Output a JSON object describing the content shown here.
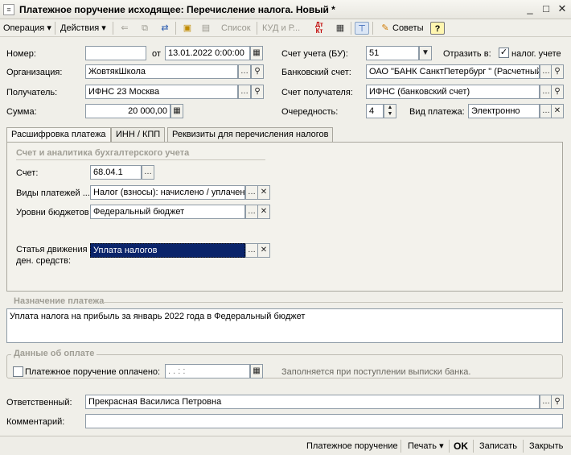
{
  "window": {
    "title": "Платежное поручение исходящее: Перечисление налога. Новый *",
    "controls": [
      "_",
      "□",
      "✕"
    ]
  },
  "toolbar": {
    "operation": "Операция",
    "actions": "Действия",
    "list": "Список",
    "kud": "КУД и Р...",
    "dt_kt": "Дт Кт",
    "advice": "Советы",
    "help": "?"
  },
  "form": {
    "number_label": "Номер:",
    "number_value": "",
    "from_label": "от",
    "date_value": "13.01.2022  0:00:00",
    "account_bu_label": "Счет учета (БУ):",
    "account_bu_value": "51",
    "reflect_label": "Отразить в:",
    "tax_accounting_label": "налог. учете",
    "tax_accounting_checked": true,
    "org_label": "Организация:",
    "org_value": "ЖовтякШкола",
    "bank_account_label": "Банковский счет:",
    "bank_account_value": "ОАО \"БАНК СанктПетербург \" (Расчетный)",
    "recipient_label": "Получатель:",
    "recipient_value": "ИФНС 23 Москва",
    "recipient_account_label": "Счет получателя:",
    "recipient_account_value": "ИФНС (банковский счет)",
    "sum_label": "Сумма:",
    "sum_value": "20 000,00",
    "priority_label": "Очередность:",
    "priority_value": "4",
    "payment_type_label": "Вид платежа:",
    "payment_type_value": "Электронно"
  },
  "tabs": [
    {
      "label": "Расшифровка платежа",
      "active": true
    },
    {
      "label": "ИНН / КПП",
      "active": false
    },
    {
      "label": "Реквизиты для перечисления налогов",
      "active": false
    }
  ],
  "decoding": {
    "group_title": "Счет и аналитика бухгалтерского учета",
    "account_label": "Счет:",
    "account_value": "68.04.1",
    "payment_kinds_label": "Виды платежей ...",
    "payment_kinds_value": "Налог (взносы): начислено / уплачено",
    "budget_levels_label": "Уровни бюджетов",
    "budget_levels_value": "Федеральный бюджет",
    "cashflow_label_1": "Статья движения",
    "cashflow_label_2": "ден. средств:",
    "cashflow_value": "Уплата налогов"
  },
  "purpose": {
    "title": "Назначение платежа",
    "text": "Уплата налога на прибыль за январь 2022 года в Федеральный бюджет"
  },
  "payment": {
    "title": "Данные об оплате",
    "paid_label": "Платежное поручение оплачено:",
    "paid_checked": false,
    "paid_date": "  .  .       :  :",
    "hint": "Заполняется при поступлении выписки банка."
  },
  "responsible": {
    "label": "Ответственный:",
    "value": "Прекрасная Василиса Петровна"
  },
  "comment": {
    "label": "Комментарий:",
    "value": ""
  },
  "statusbar": {
    "payment_order": "Платежное поручение",
    "print": "Печать",
    "ok": "OK",
    "save": "Записать",
    "close": "Закрыть"
  },
  "colors": {
    "selected_bg": "#0a246a",
    "accent": "#e8a800"
  }
}
